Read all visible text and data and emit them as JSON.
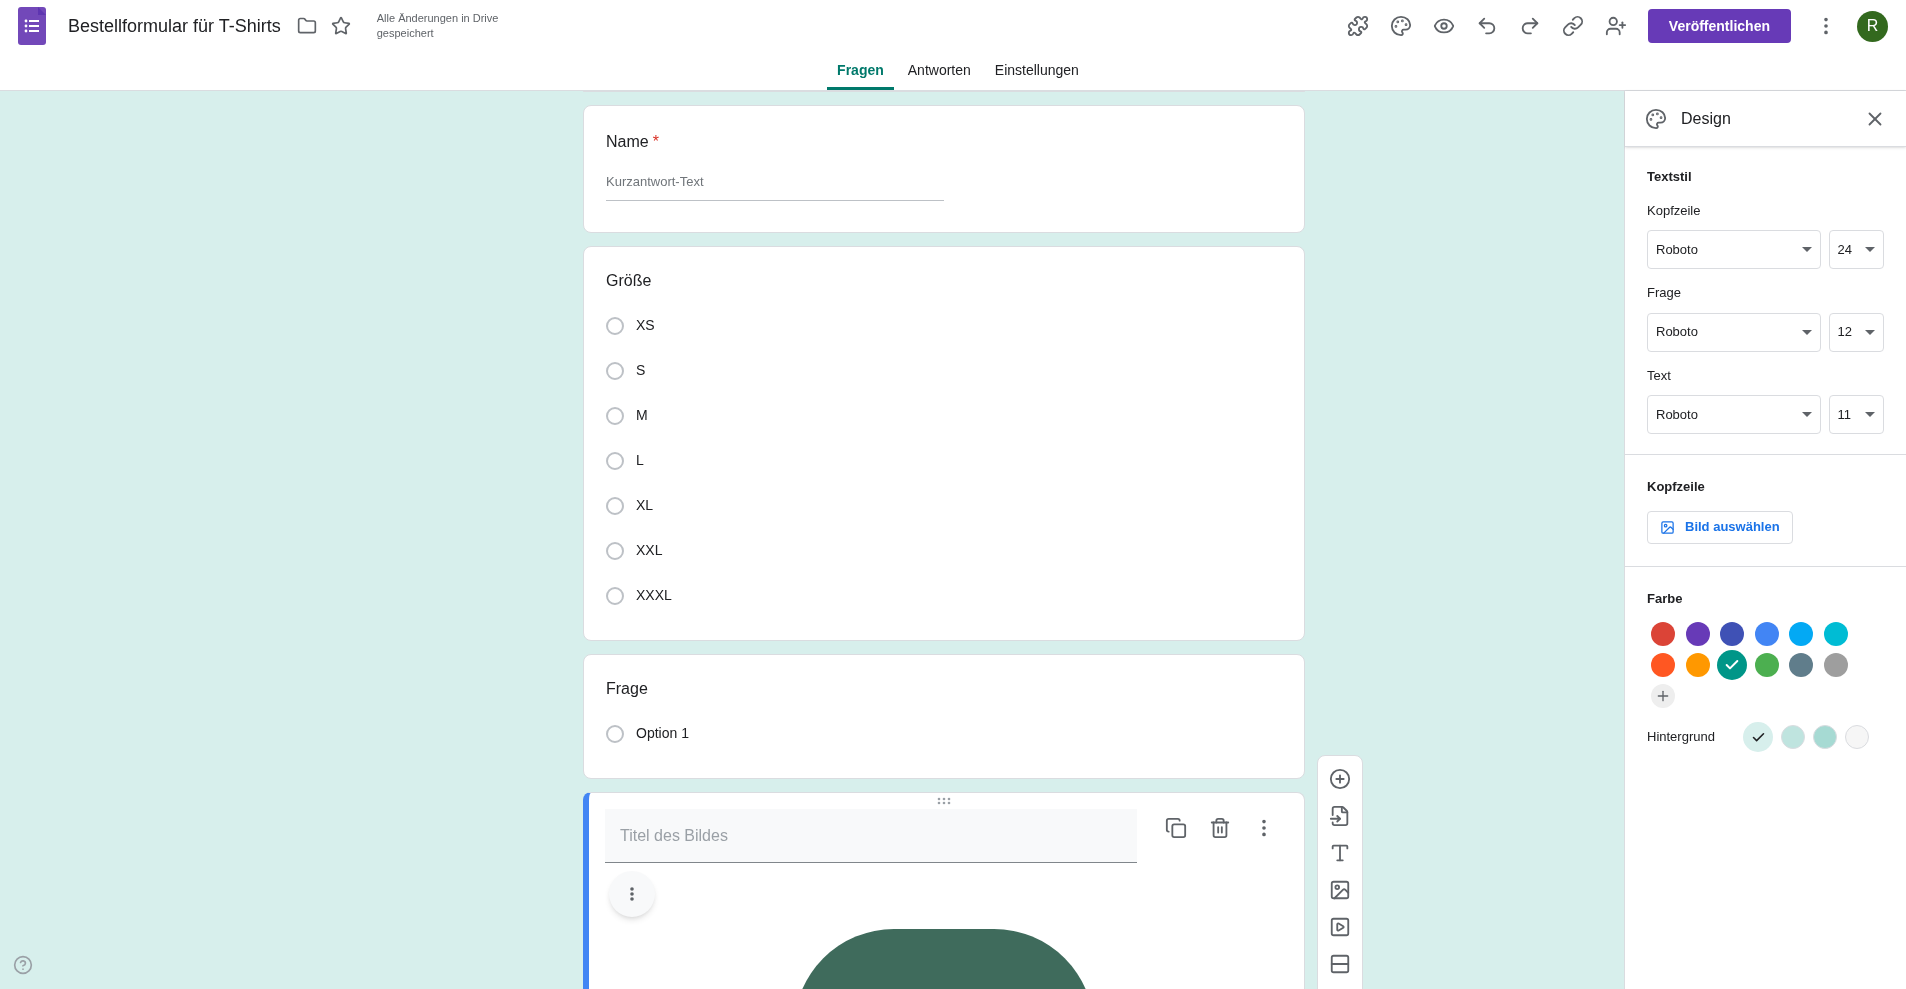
{
  "header": {
    "title": "Bestellformular für T-Shirts",
    "save_status": "Alle Änderungen in Drive gespeichert",
    "publish_button": "Veröffentlichen",
    "avatar": "R"
  },
  "tabs": [
    {
      "label": "Fragen",
      "selected": true
    },
    {
      "label": "Antworten",
      "selected": false
    },
    {
      "label": "Einstellungen",
      "selected": false
    }
  ],
  "questions": [
    {
      "kind": "short",
      "title": "Name",
      "required_mark": "*",
      "placeholder": "Kurzantwort-Text"
    },
    {
      "kind": "choice",
      "title": "Größe",
      "options": [
        {
          "label": "XS",
          "selected": false
        },
        {
          "label": "S",
          "selected": false
        },
        {
          "label": "M",
          "selected": false
        },
        {
          "label": "L",
          "selected": false
        },
        {
          "label": "XL",
          "selected": false
        },
        {
          "label": "XXL",
          "selected": false
        },
        {
          "label": "XXXL",
          "selected": false
        }
      ]
    },
    {
      "kind": "choice",
      "title": "Frage",
      "options": [
        {
          "label": "Option 1",
          "selected": false
        }
      ]
    },
    {
      "kind": "image",
      "placeholder": "Titel des Bildes"
    }
  ],
  "design": {
    "title": "Design",
    "text_style": {
      "heading": "Textstil",
      "rows": [
        {
          "label": "Kopfzeile",
          "font": "Roboto",
          "size": "24"
        },
        {
          "label": "Frage",
          "font": "Roboto",
          "size": "12"
        },
        {
          "label": "Text",
          "font": "Roboto",
          "size": "11"
        }
      ]
    },
    "header_image": {
      "heading": "Kopfzeile",
      "button": "Bild auswählen"
    },
    "color": {
      "heading": "Farbe",
      "swatches": [
        {
          "color": "#db4437",
          "selected": false
        },
        {
          "color": "#673ab7",
          "selected": false
        },
        {
          "color": "#3f51b5",
          "selected": false
        },
        {
          "color": "#4285f4",
          "selected": false
        },
        {
          "color": "#03a9f4",
          "selected": false
        },
        {
          "color": "#00bcd4",
          "selected": false
        },
        {
          "color": "#ff5722",
          "selected": false
        },
        {
          "color": "#ff9800",
          "selected": false
        },
        {
          "color": "#009688",
          "selected": true
        },
        {
          "color": "#4caf50",
          "selected": false
        },
        {
          "color": "#607d8b",
          "selected": false
        },
        {
          "color": "#9e9e9e",
          "selected": false
        }
      ],
      "background_label": "Hintergrund",
      "backgrounds": [
        {
          "color": "#d7efec",
          "selected": true
        },
        {
          "color": "#bfe4df",
          "selected": false
        },
        {
          "color": "#a6dad3",
          "selected": false
        },
        {
          "color": "#f6f6f6",
          "selected": false
        }
      ]
    }
  }
}
